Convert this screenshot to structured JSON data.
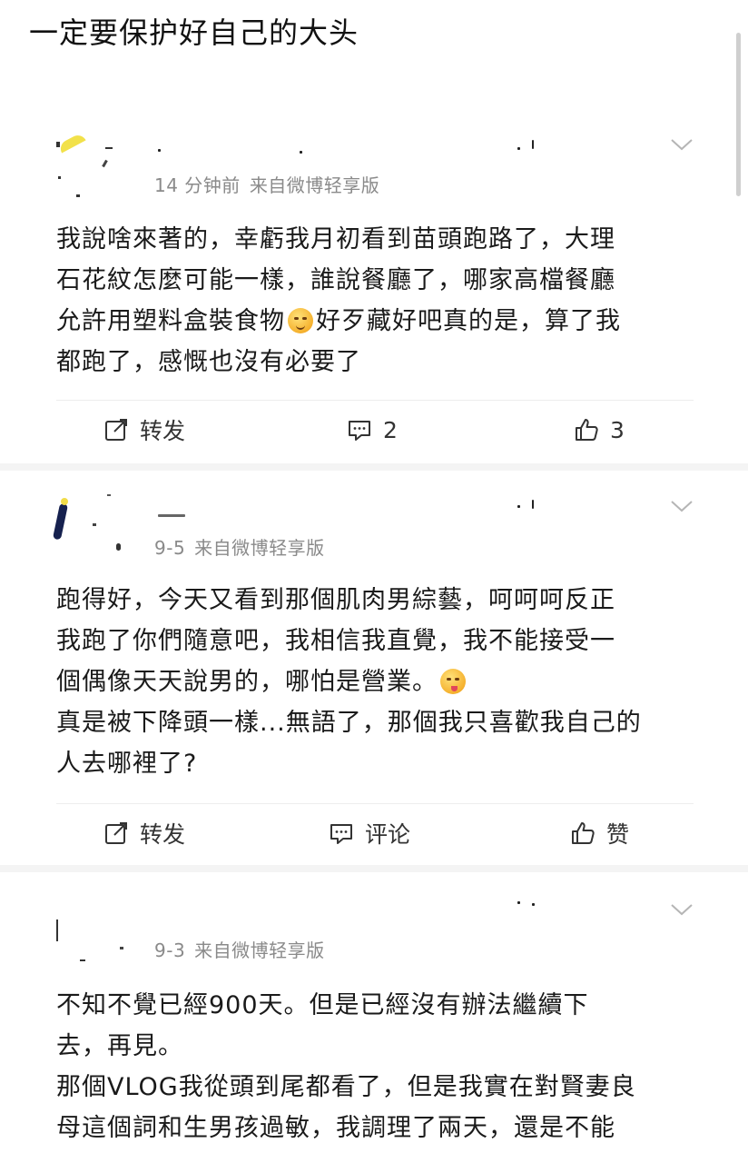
{
  "header": {
    "title": "一定要保护好自己的大头"
  },
  "posts": [
    {
      "time": "14 分钟前",
      "source": "来自微博轻享版",
      "body_lines": [
        "我說啥來著的，幸虧我月初看到苗頭跑路了，大理",
        "石花紋怎麼可能一樣，誰說餐廳了，哪家高檔餐廳",
        "允許用塑料盒裝食物",
        "好歹藏好吧真的是，算了我",
        "都跑了，感慨也沒有必要了"
      ],
      "emoji_icon": "sleepy-face-emoji",
      "actions": {
        "repost": "转发",
        "comment": "2",
        "like": "3"
      }
    },
    {
      "time": "9-5",
      "source": "来自微博轻享版",
      "body_lines": [
        "跑得好，今天又看到那個肌肉男綜藝，呵呵呵反正",
        "我跑了你們隨意吧，我相信我直覺，我不能接受一",
        "個偶像天天說男的，哪怕是營業。",
        "真是被下降頭一樣...無語了，那個我只喜歡我自己的",
        "人去哪裡了?"
      ],
      "emoji_icon": "yum-face-emoji",
      "actions": {
        "repost": "转发",
        "comment": "评论",
        "like": "赞"
      }
    },
    {
      "time": "9-3",
      "source": "来自微博轻享版",
      "body_lines": [
        "不知不覺已經900天。但是已經沒有辦法繼續下",
        "去，再見。",
        "那個VLOG我從頭到尾都看了，但是我實在對賢妻良",
        "母這個詞和生男孩過敏，我調理了兩天，還是不能"
      ]
    }
  ],
  "colors": {
    "text": "#1a1a1a",
    "meta": "#8a8a8a",
    "divider": "#ededed"
  },
  "icons": [
    "repost-icon",
    "comment-icon",
    "like-icon",
    "chevron-down-icon"
  ]
}
